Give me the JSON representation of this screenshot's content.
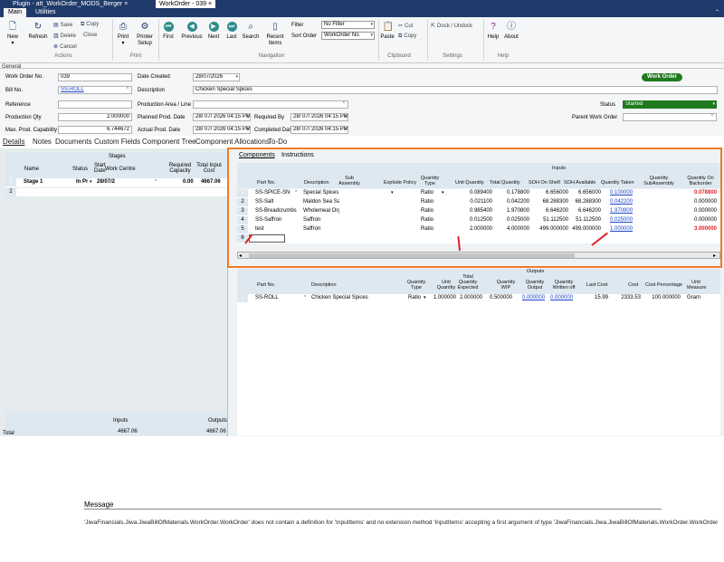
{
  "window_tabs": [
    {
      "label": "Plugin - att_WorkOrder_MODS_Berger",
      "close": "×"
    },
    {
      "label": "WorkOrder - 039",
      "close": "×"
    }
  ],
  "ribbon_tabs": [
    "Main",
    "Utilities"
  ],
  "ribbon": {
    "new": "New",
    "refresh": "Refresh",
    "save": "Save",
    "copy": "Copy",
    "delete": "Delete",
    "close": "Close",
    "cancel": "Cancel",
    "print": "Print",
    "printer_setup": "Printer Setup",
    "first": "First",
    "previous": "Previous",
    "next": "Next",
    "last": "Last",
    "search": "Search",
    "recent_items": "Recent Items",
    "filter_label": "Filter",
    "filter_value": "No Filter",
    "sort_label": "Sort Order",
    "sort_value": "WorkOrder No.",
    "paste": "Paste",
    "cut": "Cut",
    "copy2": "Copy",
    "dock_undock": "Dock / Undock",
    "help": "Help",
    "about": "About",
    "groups": {
      "actions": "Actions",
      "print": "Print",
      "navigation": "Navigation",
      "clipboard": "Clipboard",
      "settings": "Settings",
      "help": "Help"
    }
  },
  "header": {
    "section": "General",
    "work_order_no_label": "Work Order No.",
    "work_order_no": "039",
    "bill_no_label": "Bill No.",
    "bill_no": "SS-ROLL",
    "reference_label": "Reference",
    "reference": "",
    "production_qty_label": "Production Qty",
    "production_qty": "2.000000",
    "max_capability_label": "Max. Prod. Capability",
    "max_capability": "6.744672",
    "date_created_label": "Date Created",
    "date_created": "28/07/2026",
    "description_label": "Description",
    "description": "Chicken Special Spices",
    "production_area_label": "Production Area / Line",
    "production_area": "",
    "planned_date_label": "Planned Prod. Date",
    "planned_date": "28/ 07/ 2026 04:15 PM",
    "actual_date_label": "Actual Prod. Date",
    "actual_date": "28/ 07/ 2026 04:15 PM",
    "required_by_label": "Required By",
    "required_by": "28/ 07/ 2026 04:15 PM",
    "completed_label": "Completed Date",
    "completed": "28/ 07/ 2026 04:15 PM",
    "status_badge": "Work Order",
    "status_label": "Status",
    "status": "Started",
    "parent_label": "Parent Work Order",
    "parent": ""
  },
  "doc_tabs": [
    "Details",
    "Notes",
    "Documents",
    "Custom Fields",
    "Component Tree",
    "Component Allocations",
    "To-Do"
  ],
  "stages": {
    "title": "Stages",
    "columns": [
      "Name",
      "Status",
      "Start Date",
      "Work Centre",
      "Required Capacity",
      "Total Input Cost"
    ],
    "rows": [
      {
        "num": "1",
        "name": "Stage 1",
        "status": "In Pr",
        "start": "28/07/2",
        "centre": "",
        "capacity": "0.00",
        "cost": "4667.06"
      },
      {
        "num": "2",
        "name": "",
        "status": "",
        "start": "",
        "centre": "",
        "capacity": "",
        "cost": ""
      }
    ],
    "footer_inputs": "Inputs",
    "footer_outputs": "Outputs",
    "total_label": "Total",
    "total_inputs": "4667.06",
    "total_outputs": "4667.06"
  },
  "inner_tabs": [
    "Components",
    "Instructions"
  ],
  "inputs": {
    "title": "Inputs",
    "columns": [
      "Part No.",
      "Description",
      "Sub Assembly",
      "Explode Policy",
      "Quantity Type",
      "Unit Quantity",
      "Total Quantity",
      "SOH On Shelf",
      "SOH Available",
      "Quantity Taken",
      "Quantity SubAssembly",
      "Quantity On Backorder"
    ],
    "rows": [
      {
        "num": "1",
        "part": "SS-SPICE-SN",
        "desc": "Special Spices",
        "qtype": "Ratio",
        "unit": "0.089400",
        "total": "0.178800",
        "shelf": "6.656000",
        "avail": "6.656000",
        "taken": "0.100000",
        "backorder": "0.078800"
      },
      {
        "num": "2",
        "part": "SS-Salt",
        "desc": "Maldon Sea Salt",
        "qtype": "Ratio",
        "unit": "0.021100",
        "total": "0.042200",
        "shelf": "68.288300",
        "avail": "68.288300",
        "taken": "0.042200",
        "backorder": "0.000000"
      },
      {
        "num": "3",
        "part": "SS-Breadcrumbs",
        "desc": "Wholemeal Orga",
        "qtype": "Ratio",
        "unit": "0.985400",
        "total": "1.970800",
        "shelf": "6.646200",
        "avail": "6.646200",
        "taken": "1.970800",
        "backorder": "0.000000"
      },
      {
        "num": "4",
        "part": "SS-Saffron",
        "desc": "Saffron",
        "qtype": "Ratio",
        "unit": "0.012500",
        "total": "0.025000",
        "shelf": "51.112500",
        "avail": "51.112500",
        "taken": "0.025000",
        "backorder": "0.000000"
      },
      {
        "num": "5",
        "part": "test",
        "desc": "Saffron",
        "qtype": "Ratio",
        "unit": "2.000000",
        "total": "4.000000",
        "shelf": "499.000000",
        "avail": "499.000000",
        "taken": "1.000000",
        "backorder": "3.000000"
      },
      {
        "num": "6",
        "part": "",
        "desc": "",
        "qtype": "",
        "unit": "",
        "total": "",
        "shelf": "",
        "avail": "",
        "taken": "",
        "backorder": ""
      }
    ]
  },
  "outputs": {
    "title": "Outputs",
    "columns": [
      "Part No.",
      "Description",
      "Quantity Type",
      "Unit Quantity",
      "Total Quantity Expected",
      "Quantity WIP",
      "Quantity Output",
      "Quantity Written off",
      "Last Cost",
      "Cost",
      "Cost Percentage",
      "Unit Measure"
    ],
    "rows": [
      {
        "num": "1",
        "part": "SS-ROLL",
        "desc": "Chicken Special Spices",
        "qtype": "Ratio",
        "unit": "1.000000",
        "total": "2.000000",
        "wip": "0.500000",
        "output": "0.000000",
        "written": "0.000000",
        "last_cost": "15.99",
        "cost": "2333.53",
        "pct": "100.000000",
        "uom": "Gram"
      }
    ]
  },
  "message": {
    "label": "Message",
    "text": "'JiwaFinancials.Jiwa.JiwaBillOfMaterials.WorkOrder.WorkOrder' does not contain a definition for 'InputItems' and no extension method 'InputItems' accepting a first argument of type 'JiwaFinancials.Jiwa.JiwaBillOfMaterials.WorkOrder.WorkOrder' could be found ("
  },
  "colors": {
    "title_bar": "#1f3b6b",
    "highlight": "#ef7a2e",
    "status_green": "#1f7a1f",
    "error_red": "#e0202a",
    "link": "#1a44c8"
  }
}
